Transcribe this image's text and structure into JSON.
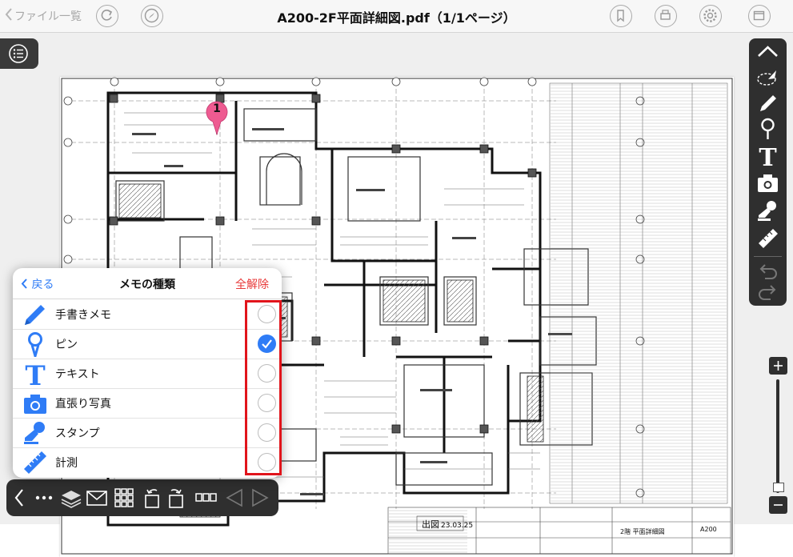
{
  "topbar": {
    "back_label": "ファイル一覧",
    "title": "A200-2F平面詳細図.pdf（1/1ページ）",
    "icons": [
      "refresh-icon",
      "compass-icon",
      "bookmark-icon",
      "print-icon",
      "settings-icon",
      "window-icon"
    ]
  },
  "pin": {
    "number": "1",
    "color": "#ee5b91"
  },
  "memo_popover": {
    "back_label": "戻る",
    "title": "メモの種類",
    "clear_label": "全解除",
    "items": [
      {
        "label": "手書きメモ",
        "icon": "pencil-icon",
        "checked": false
      },
      {
        "label": "ピン",
        "icon": "pin-icon",
        "checked": true
      },
      {
        "label": "テキスト",
        "icon": "text-icon",
        "checked": false
      },
      {
        "label": "直張り写真",
        "icon": "camera-icon",
        "checked": false
      },
      {
        "label": "スタンプ",
        "icon": "stamp-icon",
        "checked": false
      },
      {
        "label": "計測",
        "icon": "ruler-icon",
        "checked": false
      }
    ]
  },
  "drawing": {
    "stamp_label": "出図",
    "stamp_date": "23.03.25",
    "sheet_number": "A200",
    "sheet_name": "2階 平面詳細図"
  },
  "colors": {
    "accent": "#2f7cf6",
    "danger": "#e83a3a",
    "toolbar": "#2f2f2f",
    "highlight_frame": "#e1141b"
  }
}
